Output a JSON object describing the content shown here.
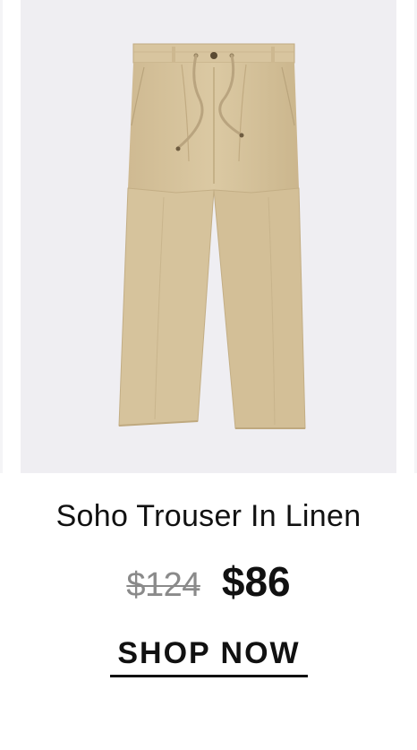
{
  "product": {
    "image_alt": "Soho Trouser In Linen",
    "title": "Soho Trouser In Linen",
    "original_price": "$124",
    "sale_price": "$86",
    "cta_label": "SHOP NOW"
  },
  "colors": {
    "image_background": "#efeef2",
    "fabric": "#d6c39c",
    "fabric_shadow": "#c3ae85",
    "drawstring": "#b9a47f",
    "text": "#111111",
    "old_price": "#8a8a8a"
  },
  "icons": {
    "product_image": "trouser-illustration"
  }
}
